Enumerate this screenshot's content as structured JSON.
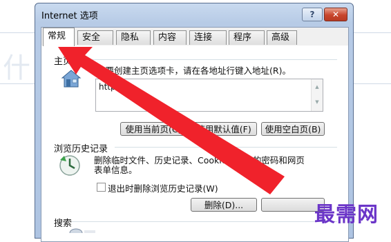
{
  "background": {
    "faint_text": "什么"
  },
  "window": {
    "title": "Internet 选项",
    "help_label": "?",
    "close_label": "✕"
  },
  "tabs": [
    {
      "label": "常规",
      "active": true
    },
    {
      "label": "安全"
    },
    {
      "label": "隐私"
    },
    {
      "label": "内容"
    },
    {
      "label": "连接"
    },
    {
      "label": "程序"
    },
    {
      "label": "高级"
    }
  ],
  "homepage": {
    "group_label": "主页",
    "description": "若要创建主页选项卡，请在各地址行键入地址(R)。",
    "address_value": "http://",
    "buttons": {
      "use_current": "使用当前页(C)",
      "use_default": "使用默认值(F)",
      "use_blank": "使用空白页(B)"
    }
  },
  "history": {
    "group_label": "浏览历史记录",
    "description_line1": "删除临时文件、历史记录、Cookie、保存的密码和网页",
    "description_line2": "表单信息。",
    "checkbox_label": "退出时删除浏览历史记录(W)",
    "delete_button": "删除(D)...",
    "settings_button": ""
  },
  "search": {
    "group_label": "搜索"
  },
  "watermark": "最需网",
  "colors": {
    "arrow": "#f0222b",
    "watermark": "#6b35c8"
  }
}
